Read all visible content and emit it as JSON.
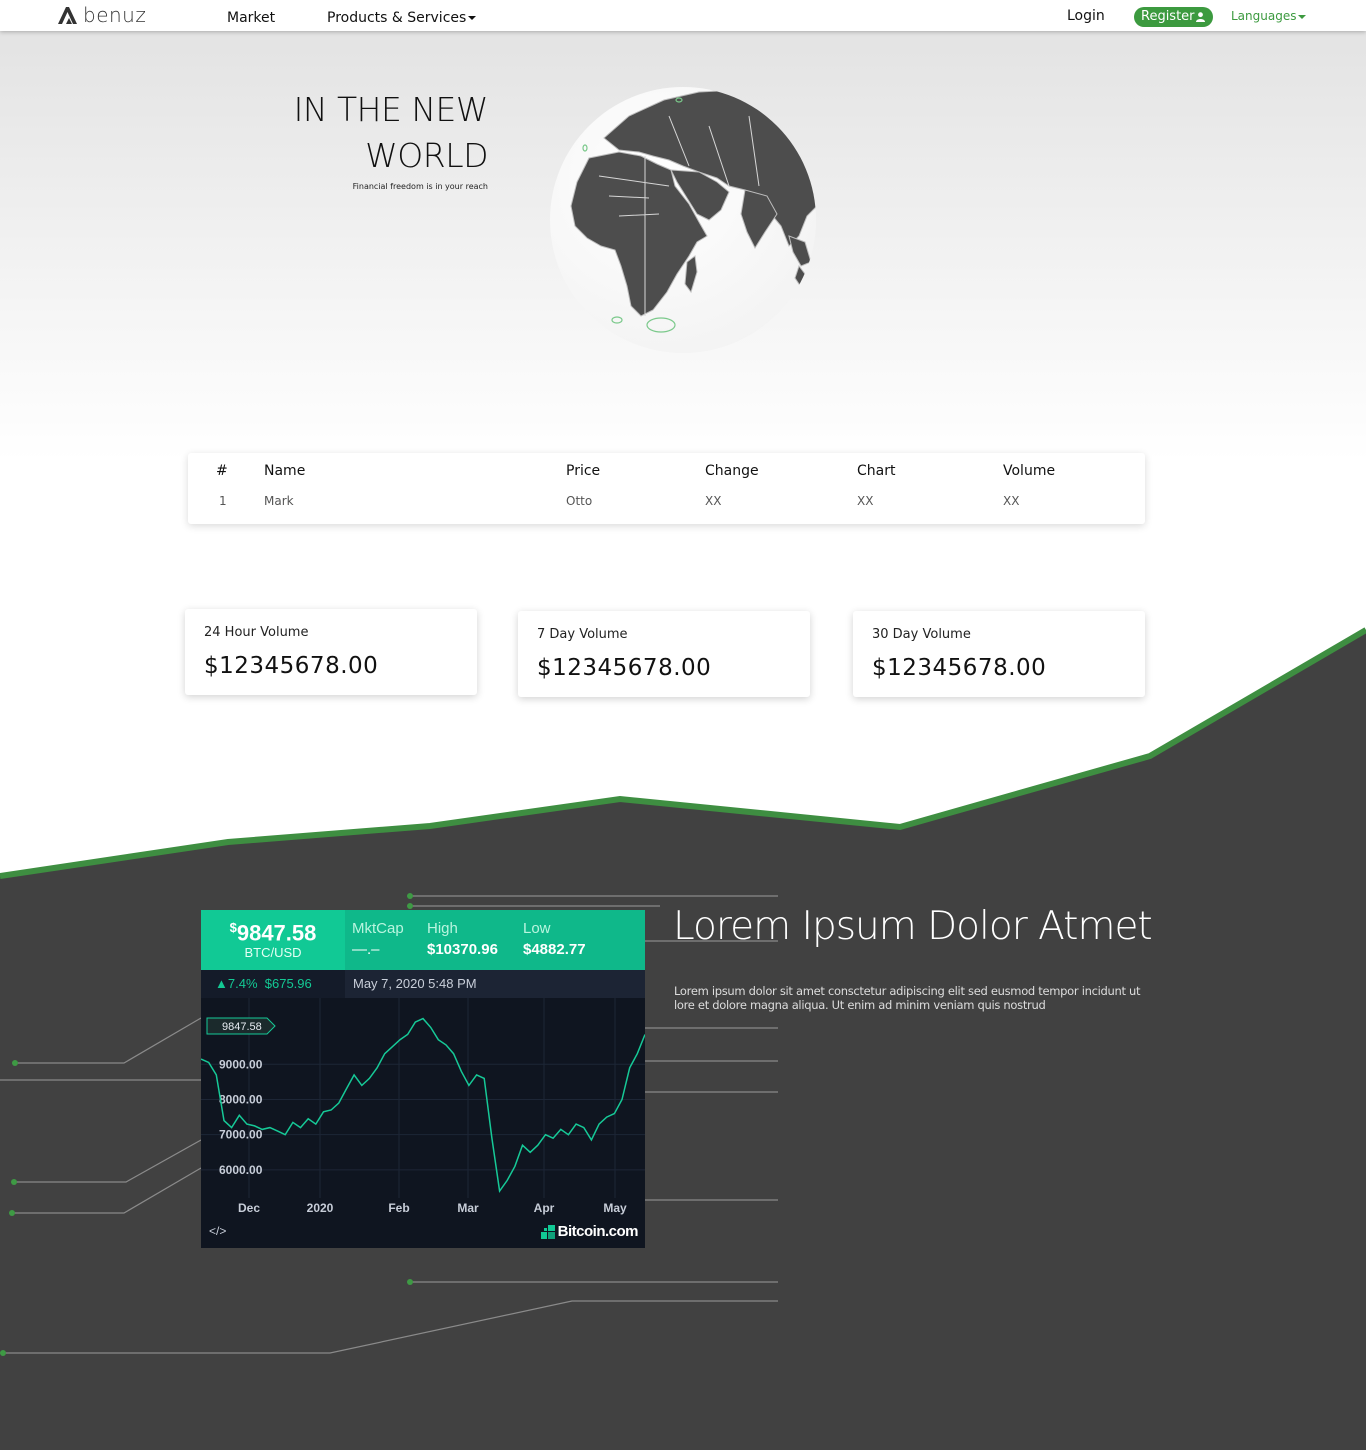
{
  "nav": {
    "logo_text": "benuz",
    "market": "Market",
    "products": "Products & Services",
    "login": "Login",
    "register": "Register",
    "languages": "Languages"
  },
  "hero": {
    "title_line1": "IN THE NEW",
    "title_line2": "WORLD",
    "subtitle": "Financial freedom is in your reach"
  },
  "table": {
    "headers": [
      "#",
      "Name",
      "Price",
      "Change",
      "Chart",
      "Volume"
    ],
    "rows": [
      [
        "1",
        "Mark",
        "Otto",
        "XX",
        "XX",
        "XX"
      ]
    ]
  },
  "stats": [
    {
      "label": "24 Hour Volume",
      "value": "$12345678.00"
    },
    {
      "label": "7 Day Volume",
      "value": "$12345678.00"
    },
    {
      "label": "30 Day Volume",
      "value": "$12345678.00"
    }
  ],
  "widget": {
    "currency_symbol": "$",
    "price": "9847.58",
    "pair": "BTC/USD",
    "mktcap_label": "MktCap",
    "mktcap_value": "—.–",
    "high_label": "High",
    "high_value": "$10370.96",
    "low_label": "Low",
    "low_value": "$4882.77",
    "change_pct": "7.4%",
    "change_abs": "$675.96",
    "date": "May 7, 2020 5:48 PM",
    "price_tag": "9847.58",
    "embed_label": "</>",
    "brand": "Bitcoin.com",
    "colors": {
      "accent": "#11c995",
      "bg": "#0f1520"
    }
  },
  "chart_data": {
    "type": "line",
    "title": "",
    "xlabel": "",
    "ylabel": "",
    "y_ticks": [
      "9000.00",
      "8000.00",
      "7000.00",
      "6000.00"
    ],
    "x_ticks": [
      "Dec",
      "2020",
      "Feb",
      "Mar",
      "Apr",
      "May"
    ],
    "ylim": [
      5200,
      10600
    ],
    "series": [
      {
        "values": [
          9150,
          9050,
          8700,
          7400,
          7200,
          7550,
          7300,
          7250,
          7150,
          7200,
          7100,
          7000,
          7350,
          7200,
          7450,
          7300,
          7650,
          7700,
          7900,
          8300,
          8700,
          8400,
          8600,
          8900,
          9300,
          9500,
          9700,
          9850,
          10200,
          10300,
          10050,
          9700,
          9550,
          9300,
          8800,
          8400,
          8700,
          8600,
          6900,
          5400,
          5700,
          6100,
          6700,
          6500,
          6700,
          7000,
          6900,
          7150,
          7000,
          7300,
          7200,
          6850,
          7300,
          7500,
          7600,
          8000,
          8900,
          9300,
          9847.58
        ]
      }
    ]
  },
  "lorem": {
    "title": "Lorem Ipsum Dolor Atmet",
    "text": "Lorem ipsum dolor sit amet consctetur adipiscing elit sed eusmod tempor incidunt ut lore et dolore magna aliqua. Ut enim ad minim veniam quis nostrud"
  }
}
